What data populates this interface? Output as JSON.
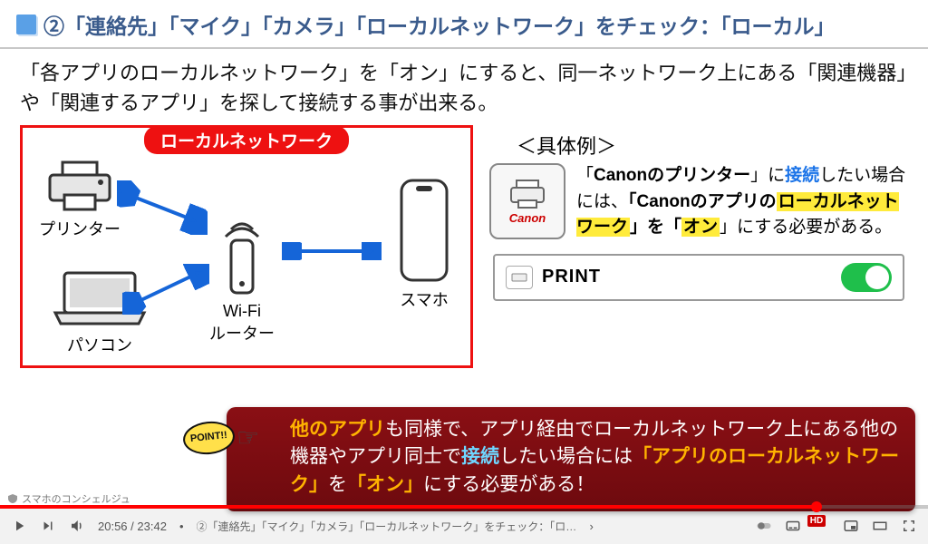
{
  "title": "②「連絡先」「マイク」「カメラ」「ローカルネットワーク」をチェック：「ローカル」",
  "description": "「各アプリのローカルネットワーク」を「オン」にすると、同一ネットワーク上にある「関連機器」や「関連するアプリ」を探して接続する事が出来る。",
  "network": {
    "label": "ローカルネットワーク",
    "devices": {
      "printer": "プリンター",
      "router_line1": "Wi-Fi",
      "router_line2": "ルーター",
      "phone": "スマホ",
      "laptop": "パソコン"
    }
  },
  "example": {
    "heading": "＜具体例＞",
    "app_brand": "Canon",
    "text": {
      "p1a": "Canonのプリンター",
      "p1b": "に",
      "p1c": "接続",
      "p1d": "したい場合には、",
      "p2a": "「Canonのアプリの",
      "p2b": "ローカルネットワーク",
      "p2c": "」を「",
      "p2d": "オン",
      "p2e": "」にする必要がある。"
    },
    "toggle": {
      "label": "PRINT",
      "state": "on"
    }
  },
  "point": {
    "badge": "POINT!!",
    "l1a": "他のアプリ",
    "l1b": "も同様で、アプリ経由でローカルネットワーク上にある他の機器やアプリ同士で",
    "l1c": "接続",
    "l1d": "したい場合には",
    "l2a": "「アプリのローカルネットワーク」",
    "l2b": "を",
    "l2c": "「オン」",
    "l2d": "にする必要がある！"
  },
  "player": {
    "time_current": "20:56",
    "time_total": "23:42",
    "chapter": "②「連絡先」「マイク」「カメラ」「ローカルネットワーク」をチェック：「ローカ…",
    "channel": "スマホのコンシェルジュ",
    "hd": "HD"
  }
}
